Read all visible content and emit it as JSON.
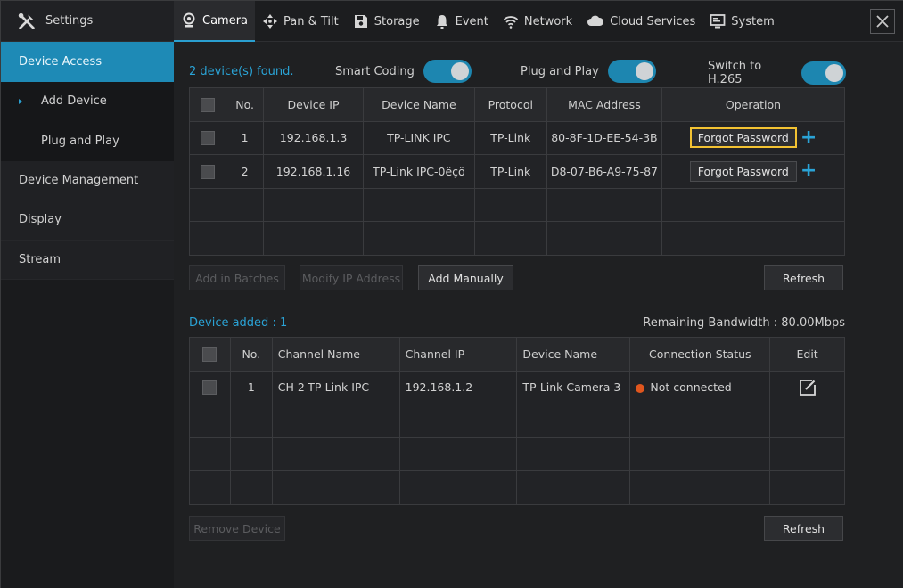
{
  "sidebar": {
    "title": "Settings",
    "items": [
      {
        "label": "Device Access"
      },
      {
        "label": "Add Device"
      },
      {
        "label": "Plug and Play"
      },
      {
        "label": "Device Management"
      },
      {
        "label": "Display"
      },
      {
        "label": "Stream"
      }
    ]
  },
  "tabs": [
    {
      "label": "Camera",
      "icon": "camera-icon"
    },
    {
      "label": "Pan & Tilt",
      "icon": "pan-tilt-icon"
    },
    {
      "label": "Storage",
      "icon": "storage-icon"
    },
    {
      "label": "Event",
      "icon": "bell-icon"
    },
    {
      "label": "Network",
      "icon": "wifi-icon"
    },
    {
      "label": "Cloud Services",
      "icon": "cloud-icon"
    },
    {
      "label": "System",
      "icon": "monitor-icon"
    }
  ],
  "search": {
    "found_text": "2 device(s) found.",
    "smart_coding_label": "Smart Coding",
    "plug_play_label": "Plug and Play",
    "h265_label": "Switch to H.265"
  },
  "found_table": {
    "headers": [
      "No.",
      "Device IP",
      "Device Name",
      "Protocol",
      "MAC Address",
      "Operation"
    ],
    "rows": [
      {
        "no": "1",
        "ip": "192.168.1.3",
        "name": "TP-LINK IPC",
        "protocol": "TP-Link",
        "mac": "80-8F-1D-EE-54-3B",
        "op": "Forgot Password"
      },
      {
        "no": "2",
        "ip": "192.168.1.16",
        "name": "TP-Link IPC-0ëçö",
        "protocol": "TP-Link",
        "mac": "D8-07-B6-A9-75-87",
        "op": "Forgot Password"
      }
    ]
  },
  "buttons": {
    "add_batches": "Add in Batches",
    "modify_ip": "Modify IP Address",
    "add_manually": "Add Manually",
    "refresh": "Refresh",
    "remove_device": "Remove Device"
  },
  "added": {
    "label": "Device added : 1",
    "bandwidth": "Remaining Bandwidth : 80.00Mbps"
  },
  "added_table": {
    "headers": [
      "No.",
      "Channel Name",
      "Channel IP",
      "Device Name",
      "Connection Status",
      "Edit"
    ],
    "rows": [
      {
        "no": "1",
        "channel": "CH 2-TP-Link IPC",
        "ip": "192.168.1.2",
        "name": "TP-Link Camera 3",
        "status": "Not connected"
      }
    ]
  },
  "colors": {
    "accent": "#2aa3d6",
    "highlight": "#f2c232",
    "status_error": "#e0561e"
  }
}
